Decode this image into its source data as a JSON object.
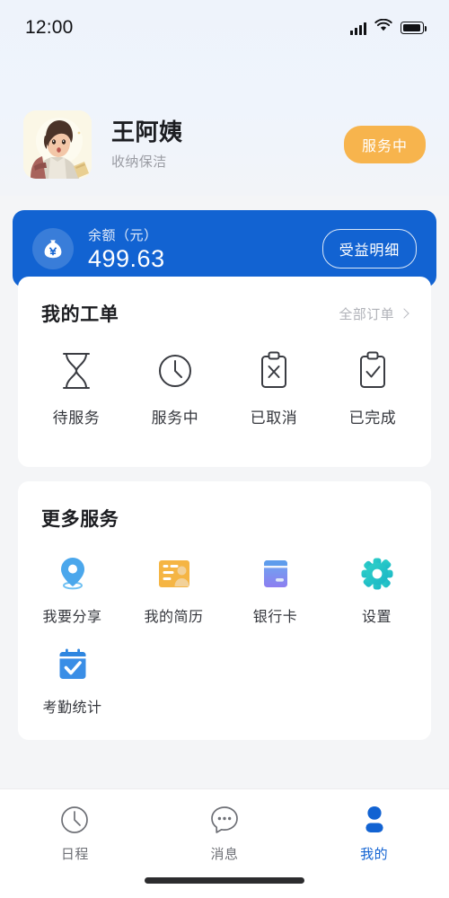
{
  "status_bar": {
    "time": "12:00",
    "signal_icon": "cellular-signal-icon",
    "wifi_icon": "wifi-icon",
    "battery_icon": "battery-icon"
  },
  "profile": {
    "avatar_icon": "user-avatar-illustration",
    "name": "王阿姨",
    "subtitle": "收纳保洁",
    "status_badge": "服务中",
    "badge_color": "#F7B44D"
  },
  "balance_card": {
    "icon": "money-bag-icon",
    "label": "余额（元）",
    "amount": "499.63",
    "detail_button": "受益明细",
    "background_color": "#1263D2"
  },
  "orders_card": {
    "title": "我的工单",
    "more_label": "全部订单",
    "more_icon": "chevron-right-icon",
    "items": [
      {
        "label": "待服务",
        "icon": "hourglass-icon"
      },
      {
        "label": "服务中",
        "icon": "clock-icon"
      },
      {
        "label": "已取消",
        "icon": "clipboard-x-icon"
      },
      {
        "label": "已完成",
        "icon": "clipboard-check-icon"
      }
    ]
  },
  "services_card": {
    "title": "更多服务",
    "items": [
      {
        "label": "我要分享",
        "icon": "location-pin-icon",
        "color": "#4BA7EC"
      },
      {
        "label": "我的简历",
        "icon": "id-card-icon",
        "color": "#F5B544"
      },
      {
        "label": "银行卡",
        "icon": "bank-card-icon",
        "color": "#7C7CE8"
      },
      {
        "label": "设置",
        "icon": "gear-icon",
        "color": "#2FC6C6"
      },
      {
        "label": "考勤统计",
        "icon": "calendar-check-icon",
        "color": "#2E86E0"
      }
    ]
  },
  "tab_bar": {
    "active_color": "#1263D2",
    "inactive_color": "#6E7076",
    "tabs": [
      {
        "label": "日程",
        "icon": "clock-icon",
        "active": false
      },
      {
        "label": "消息",
        "icon": "chat-bubble-icon",
        "active": false
      },
      {
        "label": "我的",
        "icon": "person-icon",
        "active": true
      }
    ]
  }
}
